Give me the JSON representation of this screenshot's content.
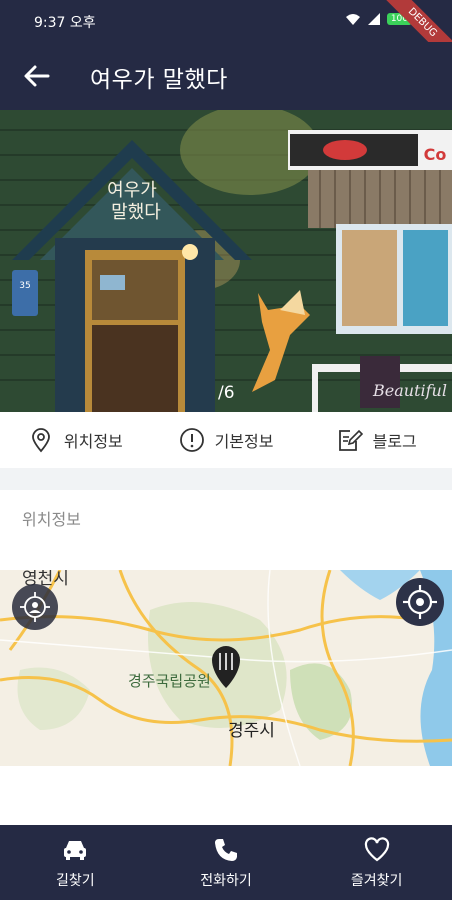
{
  "status": {
    "time": "9:37 오후",
    "battery": "100",
    "debug": "DEBUG"
  },
  "header": {
    "title": "여우가 말했다"
  },
  "photo": {
    "counter": "/6",
    "sign_line1": "여우가",
    "sign_line2": "말했다",
    "door_number": "35",
    "shop_sign": "Co",
    "board_text": "Beautiful"
  },
  "tabs": [
    {
      "label": "위치정보",
      "icon": "location-pin-icon"
    },
    {
      "label": "기본정보",
      "icon": "info-icon"
    },
    {
      "label": "블로그",
      "icon": "blog-edit-icon"
    }
  ],
  "location": {
    "section_title": "위치정보",
    "map_labels": {
      "top_left": "영천시",
      "park": "경주국립공원",
      "city": "경주시"
    }
  },
  "bottom_nav": [
    {
      "label": "길찾기",
      "icon": "car-icon"
    },
    {
      "label": "전화하기",
      "icon": "phone-icon"
    },
    {
      "label": "즐겨찾기",
      "icon": "heart-icon"
    }
  ]
}
